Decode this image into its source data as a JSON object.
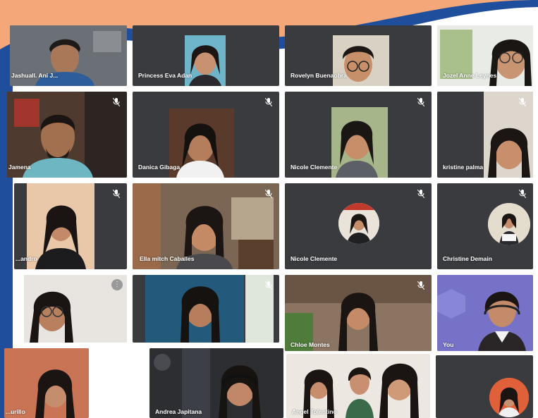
{
  "participants": [
    {
      "name": "Jashuall. Ani J..."
    },
    {
      "name": "Princess Eva Adan"
    },
    {
      "name": "Rovelyn Buenaobra"
    },
    {
      "name": "Jozel Anne Leynes"
    },
    {
      "name": "Jamena"
    },
    {
      "name": "Danica Gibaga"
    },
    {
      "name": "Nicole Clemente"
    },
    {
      "name": "kristine palma"
    },
    {
      "name": "...andro"
    },
    {
      "name": "Ella mitch Caballes"
    },
    {
      "name": "Nicole Clemente"
    },
    {
      "name": "Christine Demain"
    },
    {
      "name": ""
    },
    {
      "name": ""
    },
    {
      "name": "Chloe Montes"
    },
    {
      "name": "You"
    },
    {
      "name": "...urillo"
    },
    {
      "name": "Andrea Japitana"
    },
    {
      "name": "Angel Tolentino"
    },
    {
      "name": ""
    }
  ],
  "colors": {
    "background_orange": "#f4a879",
    "wave_blue": "#1f4f9c",
    "tile_gray": "#3a3b3f"
  }
}
